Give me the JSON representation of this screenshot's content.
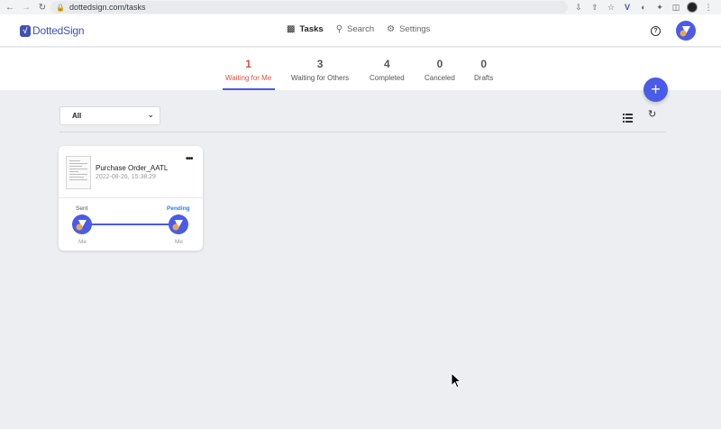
{
  "browser": {
    "url": "dottedsign.com/tasks"
  },
  "app": {
    "logo_text": "DottedSign",
    "nav": [
      {
        "label": "Tasks",
        "icon": "inbox-icon",
        "active": true
      },
      {
        "label": "Search",
        "icon": "search-icon",
        "active": false
      },
      {
        "label": "Settings",
        "icon": "gear-icon",
        "active": false
      }
    ],
    "help_icon_text": "?"
  },
  "tabs": [
    {
      "count": "1",
      "label": "Waiting for Me",
      "active": true
    },
    {
      "count": "3",
      "label": "Waiting for Others",
      "active": false
    },
    {
      "count": "4",
      "label": "Completed",
      "active": false
    },
    {
      "count": "0",
      "label": "Canceled",
      "active": false
    },
    {
      "count": "0",
      "label": "Drafts",
      "active": false
    }
  ],
  "fab_label": "+",
  "filter": {
    "selected": "All"
  },
  "task": {
    "title": "Purchase Order_AATL",
    "date": "2022-08-26, 15:38:29",
    "menu": "•••",
    "steps": [
      {
        "status": "Sent",
        "who": "Me"
      },
      {
        "status": "Pending",
        "who": "Me"
      }
    ]
  },
  "colors": {
    "accent": "#4a5be8",
    "active_tab": "#d9543d",
    "pending": "#2f7be5",
    "avatar_orange": "#f0a640"
  }
}
